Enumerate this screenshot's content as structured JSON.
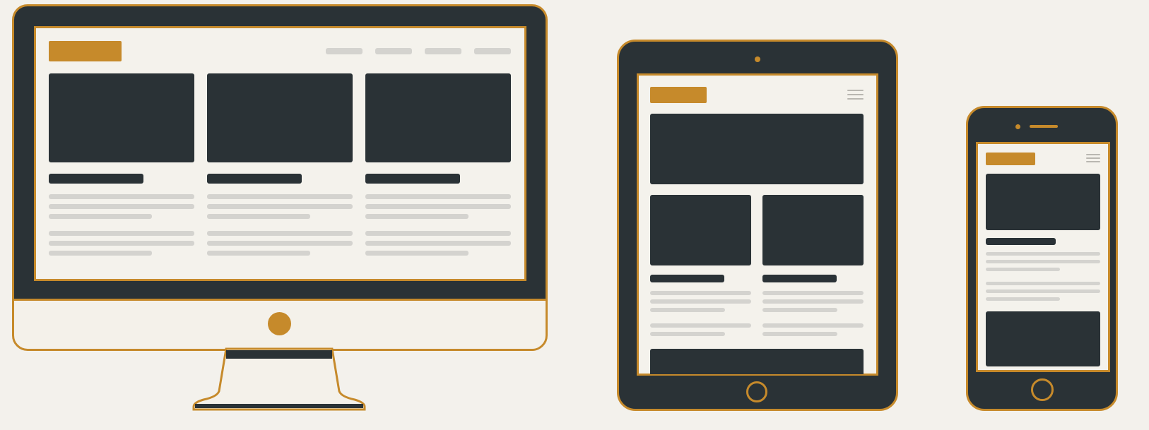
{
  "colors": {
    "accent": "#c68a2b",
    "dark": "#2a3236",
    "screen": "#f4f2ec",
    "line": "#d4d3cf"
  },
  "devices": {
    "desktop": {
      "icon": "desktop-monitor-icon",
      "columns": 3
    },
    "tablet": {
      "icon": "tablet-icon",
      "menu_icon": "hamburger-menu-icon"
    },
    "phone": {
      "icon": "smartphone-icon",
      "menu_icon": "hamburger-menu-icon"
    }
  }
}
